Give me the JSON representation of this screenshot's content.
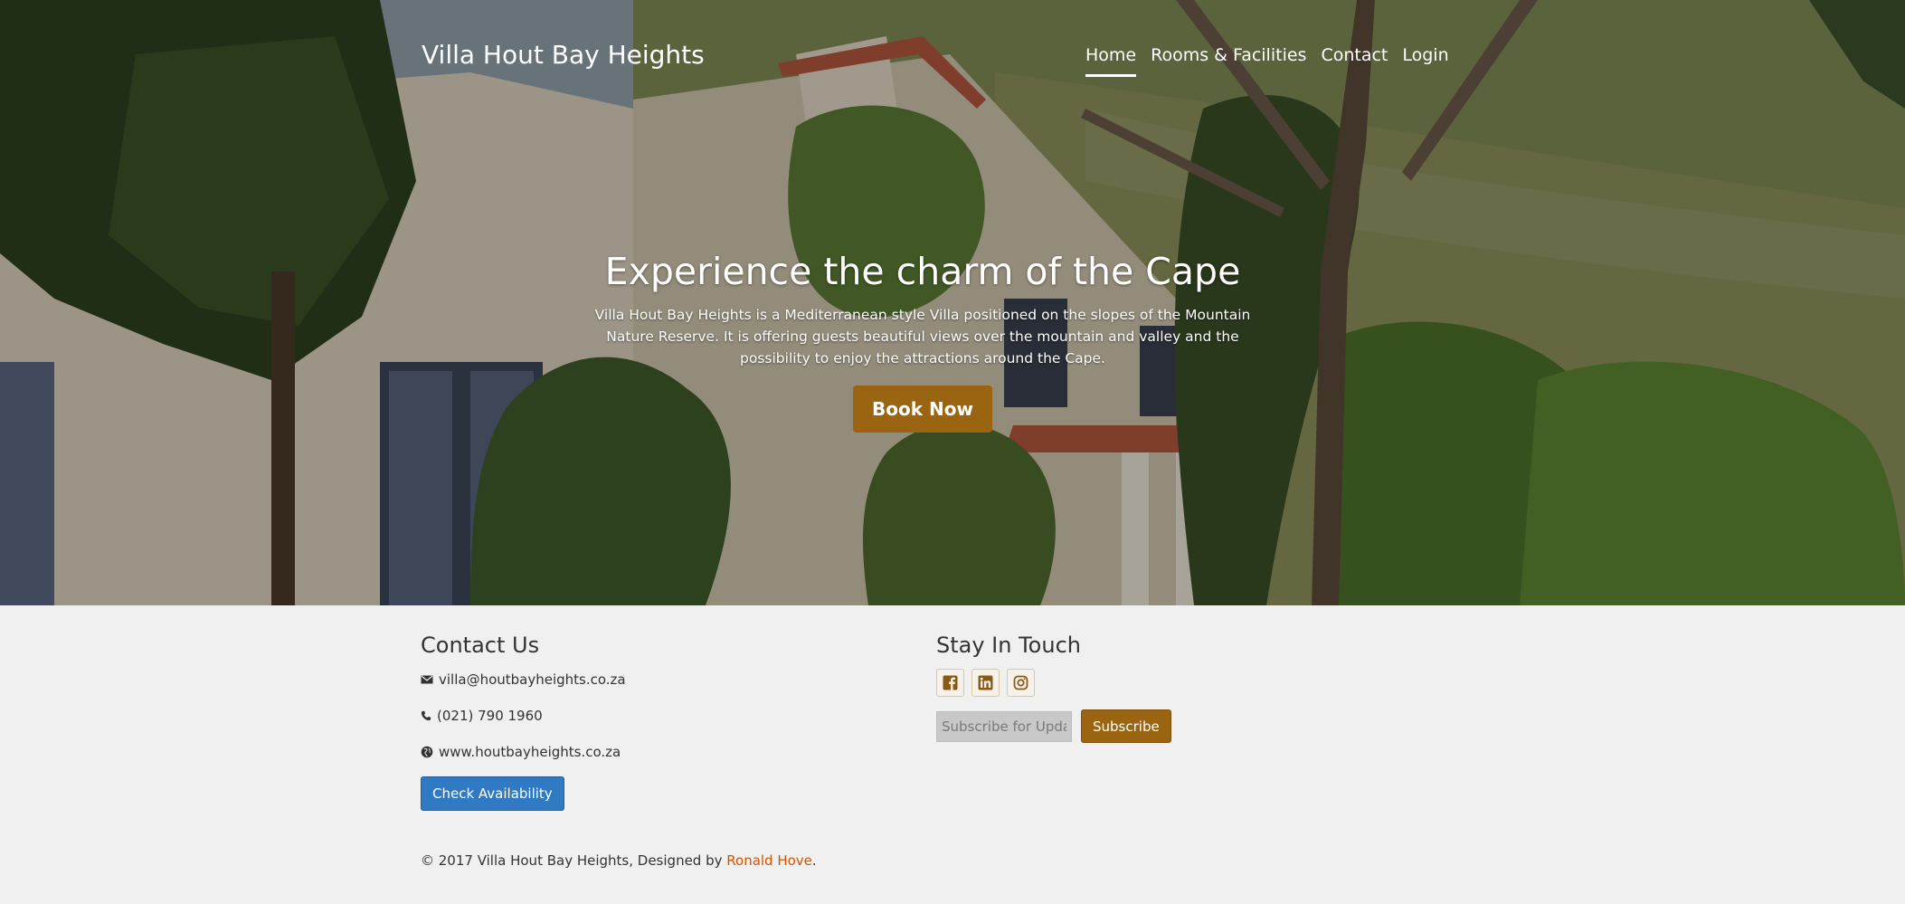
{
  "header": {
    "brand": "Villa Hout Bay Heights",
    "nav": [
      {
        "label": "Home",
        "active": true
      },
      {
        "label": "Rooms & Facilities",
        "active": false
      },
      {
        "label": "Contact",
        "active": false
      },
      {
        "label": "Login",
        "active": false
      }
    ]
  },
  "hero": {
    "title": "Experience the charm of the Cape",
    "text": "Villa Hout Bay Heights is a Mediterranean style Villa positioned on the slopes of the Mountain Nature Reserve. It is offering guests beautiful views over the mountain and valley and the possibility to enjoy the attractions around the Cape.",
    "cta": "Book Now"
  },
  "contact": {
    "title": "Contact Us",
    "email": "villa@houtbayheights.co.za",
    "phone": "(021) 790 1960",
    "website": "www.houtbayheights.co.za",
    "check_label": "Check Availability"
  },
  "stay": {
    "title": "Stay In Touch",
    "social": [
      "facebook-icon",
      "linkedin-icon",
      "instagram-icon"
    ],
    "subscribe_placeholder": "Subscribe for Updates",
    "subscribe_label": "Subscribe"
  },
  "footer": {
    "copyright_prefix": "© 2017 Villa Hout Bay Heights, Designed by ",
    "designer": "Ronald Hove",
    "copyright_suffix": "."
  },
  "colors": {
    "accent": "#9b6410",
    "primary_button": "#2f7ac3",
    "link": "#d35400"
  }
}
